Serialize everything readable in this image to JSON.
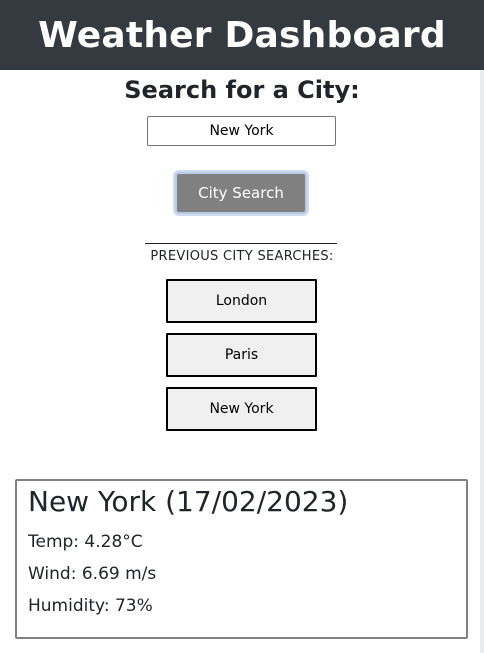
{
  "header": {
    "title": "Weather Dashboard"
  },
  "search": {
    "heading": "Search for a City:",
    "input_value": "New York",
    "button_label": "City Search"
  },
  "history": {
    "heading": "PREVIOUS CITY SEARCHES:",
    "items": [
      {
        "label": "London"
      },
      {
        "label": "Paris"
      },
      {
        "label": "New York"
      }
    ]
  },
  "current": {
    "title": "New York (17/02/2023)",
    "temp": "Temp: 4.28°C",
    "wind": "Wind: 6.69 m/s",
    "humidity": "Humidity: 73%"
  }
}
